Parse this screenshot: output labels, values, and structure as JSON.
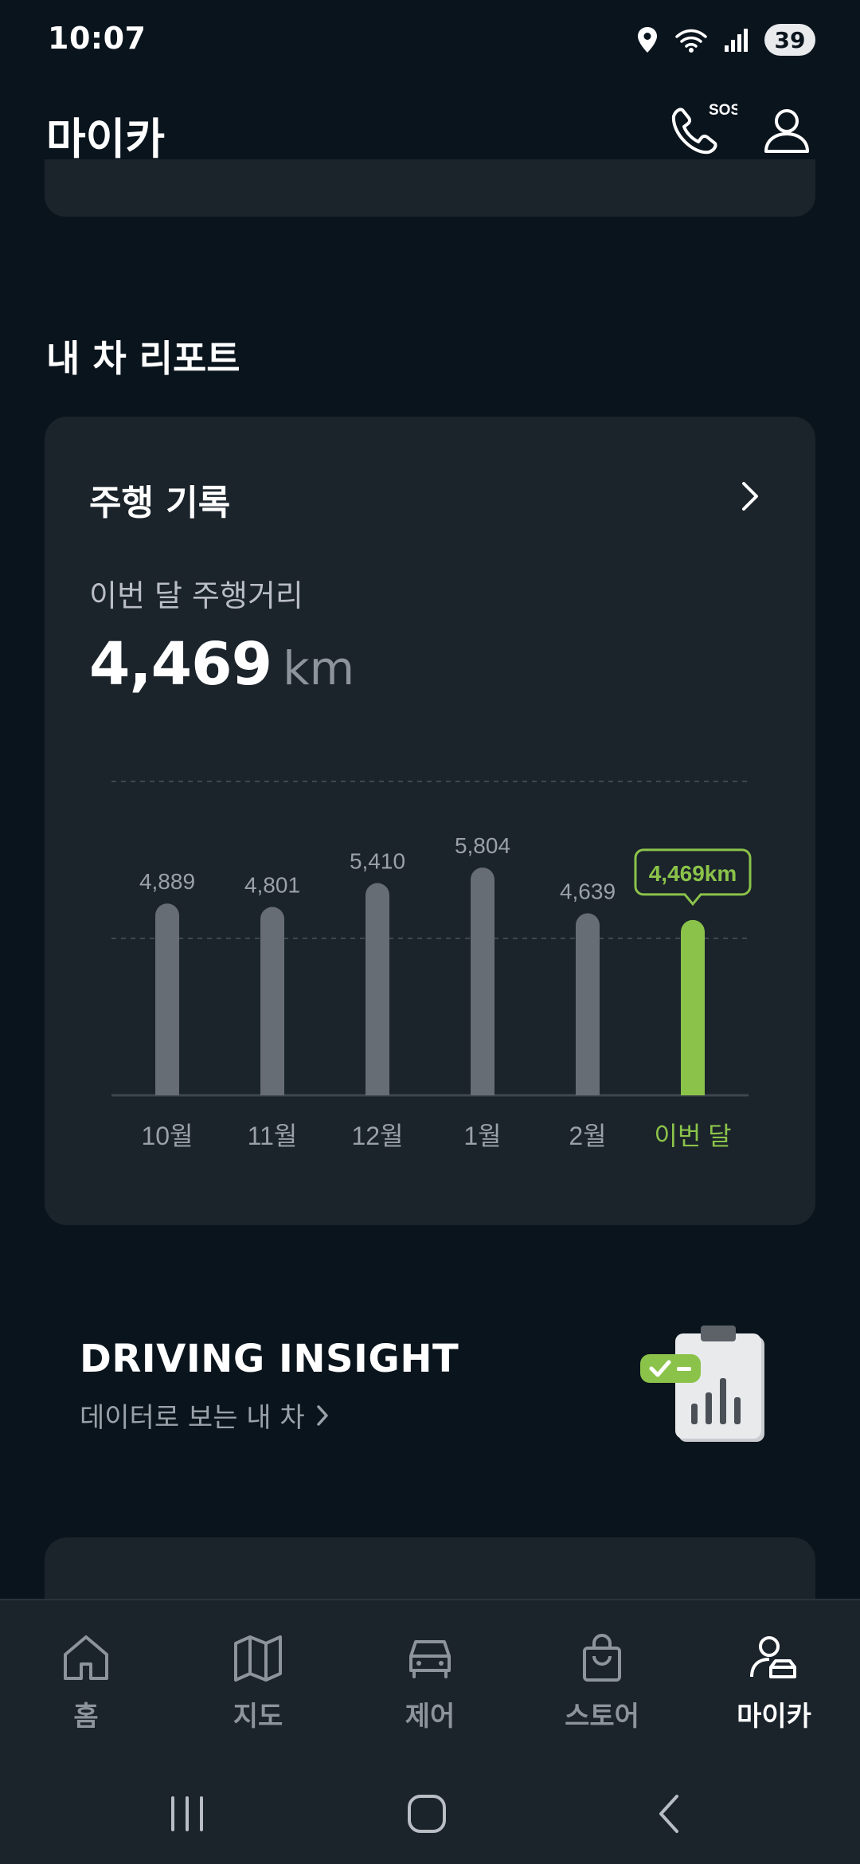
{
  "status_bar": {
    "time": "10:07",
    "battery": "39"
  },
  "header": {
    "title": "마이카",
    "sos_label": "SOS"
  },
  "report_section": {
    "title": "내 차 리포트"
  },
  "driving_card": {
    "title": "주행 기록",
    "distance_label": "이번 달 주행거리",
    "distance_value": "4,469",
    "distance_unit": "km"
  },
  "chart_data": {
    "type": "bar",
    "categories": [
      "10월",
      "11월",
      "12월",
      "1월",
      "2월",
      "이번 달"
    ],
    "values": [
      4889,
      4801,
      5410,
      5804,
      4639,
      4469
    ],
    "data_labels": [
      "4,889",
      "4,801",
      "5,410",
      "5,804",
      "4,639",
      "4,469km"
    ],
    "highlight_index": 5,
    "ylim": [
      0,
      8000
    ],
    "gridlines": [
      4000,
      8000
    ],
    "colors": {
      "bar": "#676d74",
      "highlight": "#8bc34a",
      "label": "#9aa1a8"
    }
  },
  "insight": {
    "title": "DRIVING INSIGHT",
    "subtitle": "데이터로 보는 내 차"
  },
  "tabs": [
    {
      "label": "홈",
      "icon": "home-icon",
      "active": false
    },
    {
      "label": "지도",
      "icon": "map-icon",
      "active": false
    },
    {
      "label": "제어",
      "icon": "car-icon",
      "active": false
    },
    {
      "label": "스토어",
      "icon": "shopping-bag-icon",
      "active": false
    },
    {
      "label": "마이카",
      "icon": "my-car-icon",
      "active": true
    }
  ]
}
